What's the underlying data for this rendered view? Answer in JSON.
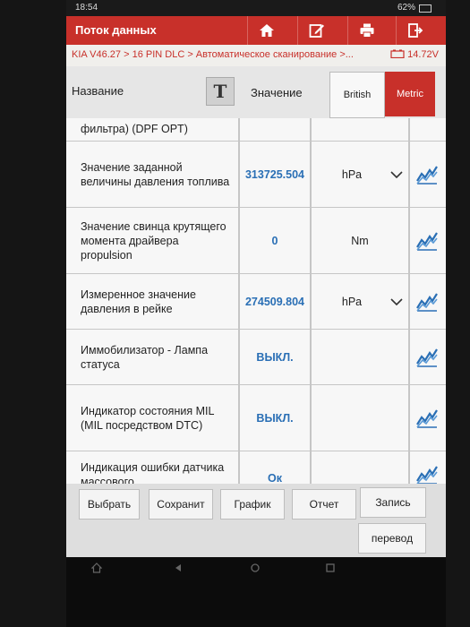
{
  "status": {
    "time": "18:54",
    "battery": "62%"
  },
  "titlebar": {
    "title": "Поток данных"
  },
  "breadcrumb": {
    "path": "KIA V46.27 > 16 PIN DLC > Автоматическое сканирование >...",
    "voltage": "14.72V"
  },
  "header": {
    "name": "Название",
    "t_label": "T",
    "value": "Значение",
    "british": "British",
    "metric": "Metric"
  },
  "rows": [
    {
      "name": "фильтра) (DPF OPT)",
      "value": "",
      "unit": ""
    },
    {
      "name": "Значение заданной величины давления топлива",
      "value": "313725.504",
      "unit": "hPa"
    },
    {
      "name": "Значение свинца крутящего момента драйвера propulsion",
      "value": "0",
      "unit": "Nm"
    },
    {
      "name": "Измеренное значение давления в рейке",
      "value": "274509.804",
      "unit": "hPa"
    },
    {
      "name": "Иммобилизатор - Лампа статуса",
      "value": "ВЫКЛ.",
      "unit": ""
    },
    {
      "name": "Индикатор состояния MIL (MIL посредством DTC)",
      "value": "ВЫКЛ.",
      "unit": ""
    },
    {
      "name": "Индикация ошибки датчика массового",
      "value": "Ок",
      "unit": ""
    }
  ],
  "buttons": {
    "select": "Выбрать",
    "save": "Сохранит",
    "graph": "График",
    "report": "Отчет",
    "record": "Запись",
    "translate": "перевод"
  },
  "colors": {
    "accent": "#c8302a",
    "value_blue": "#2a6fb5"
  }
}
